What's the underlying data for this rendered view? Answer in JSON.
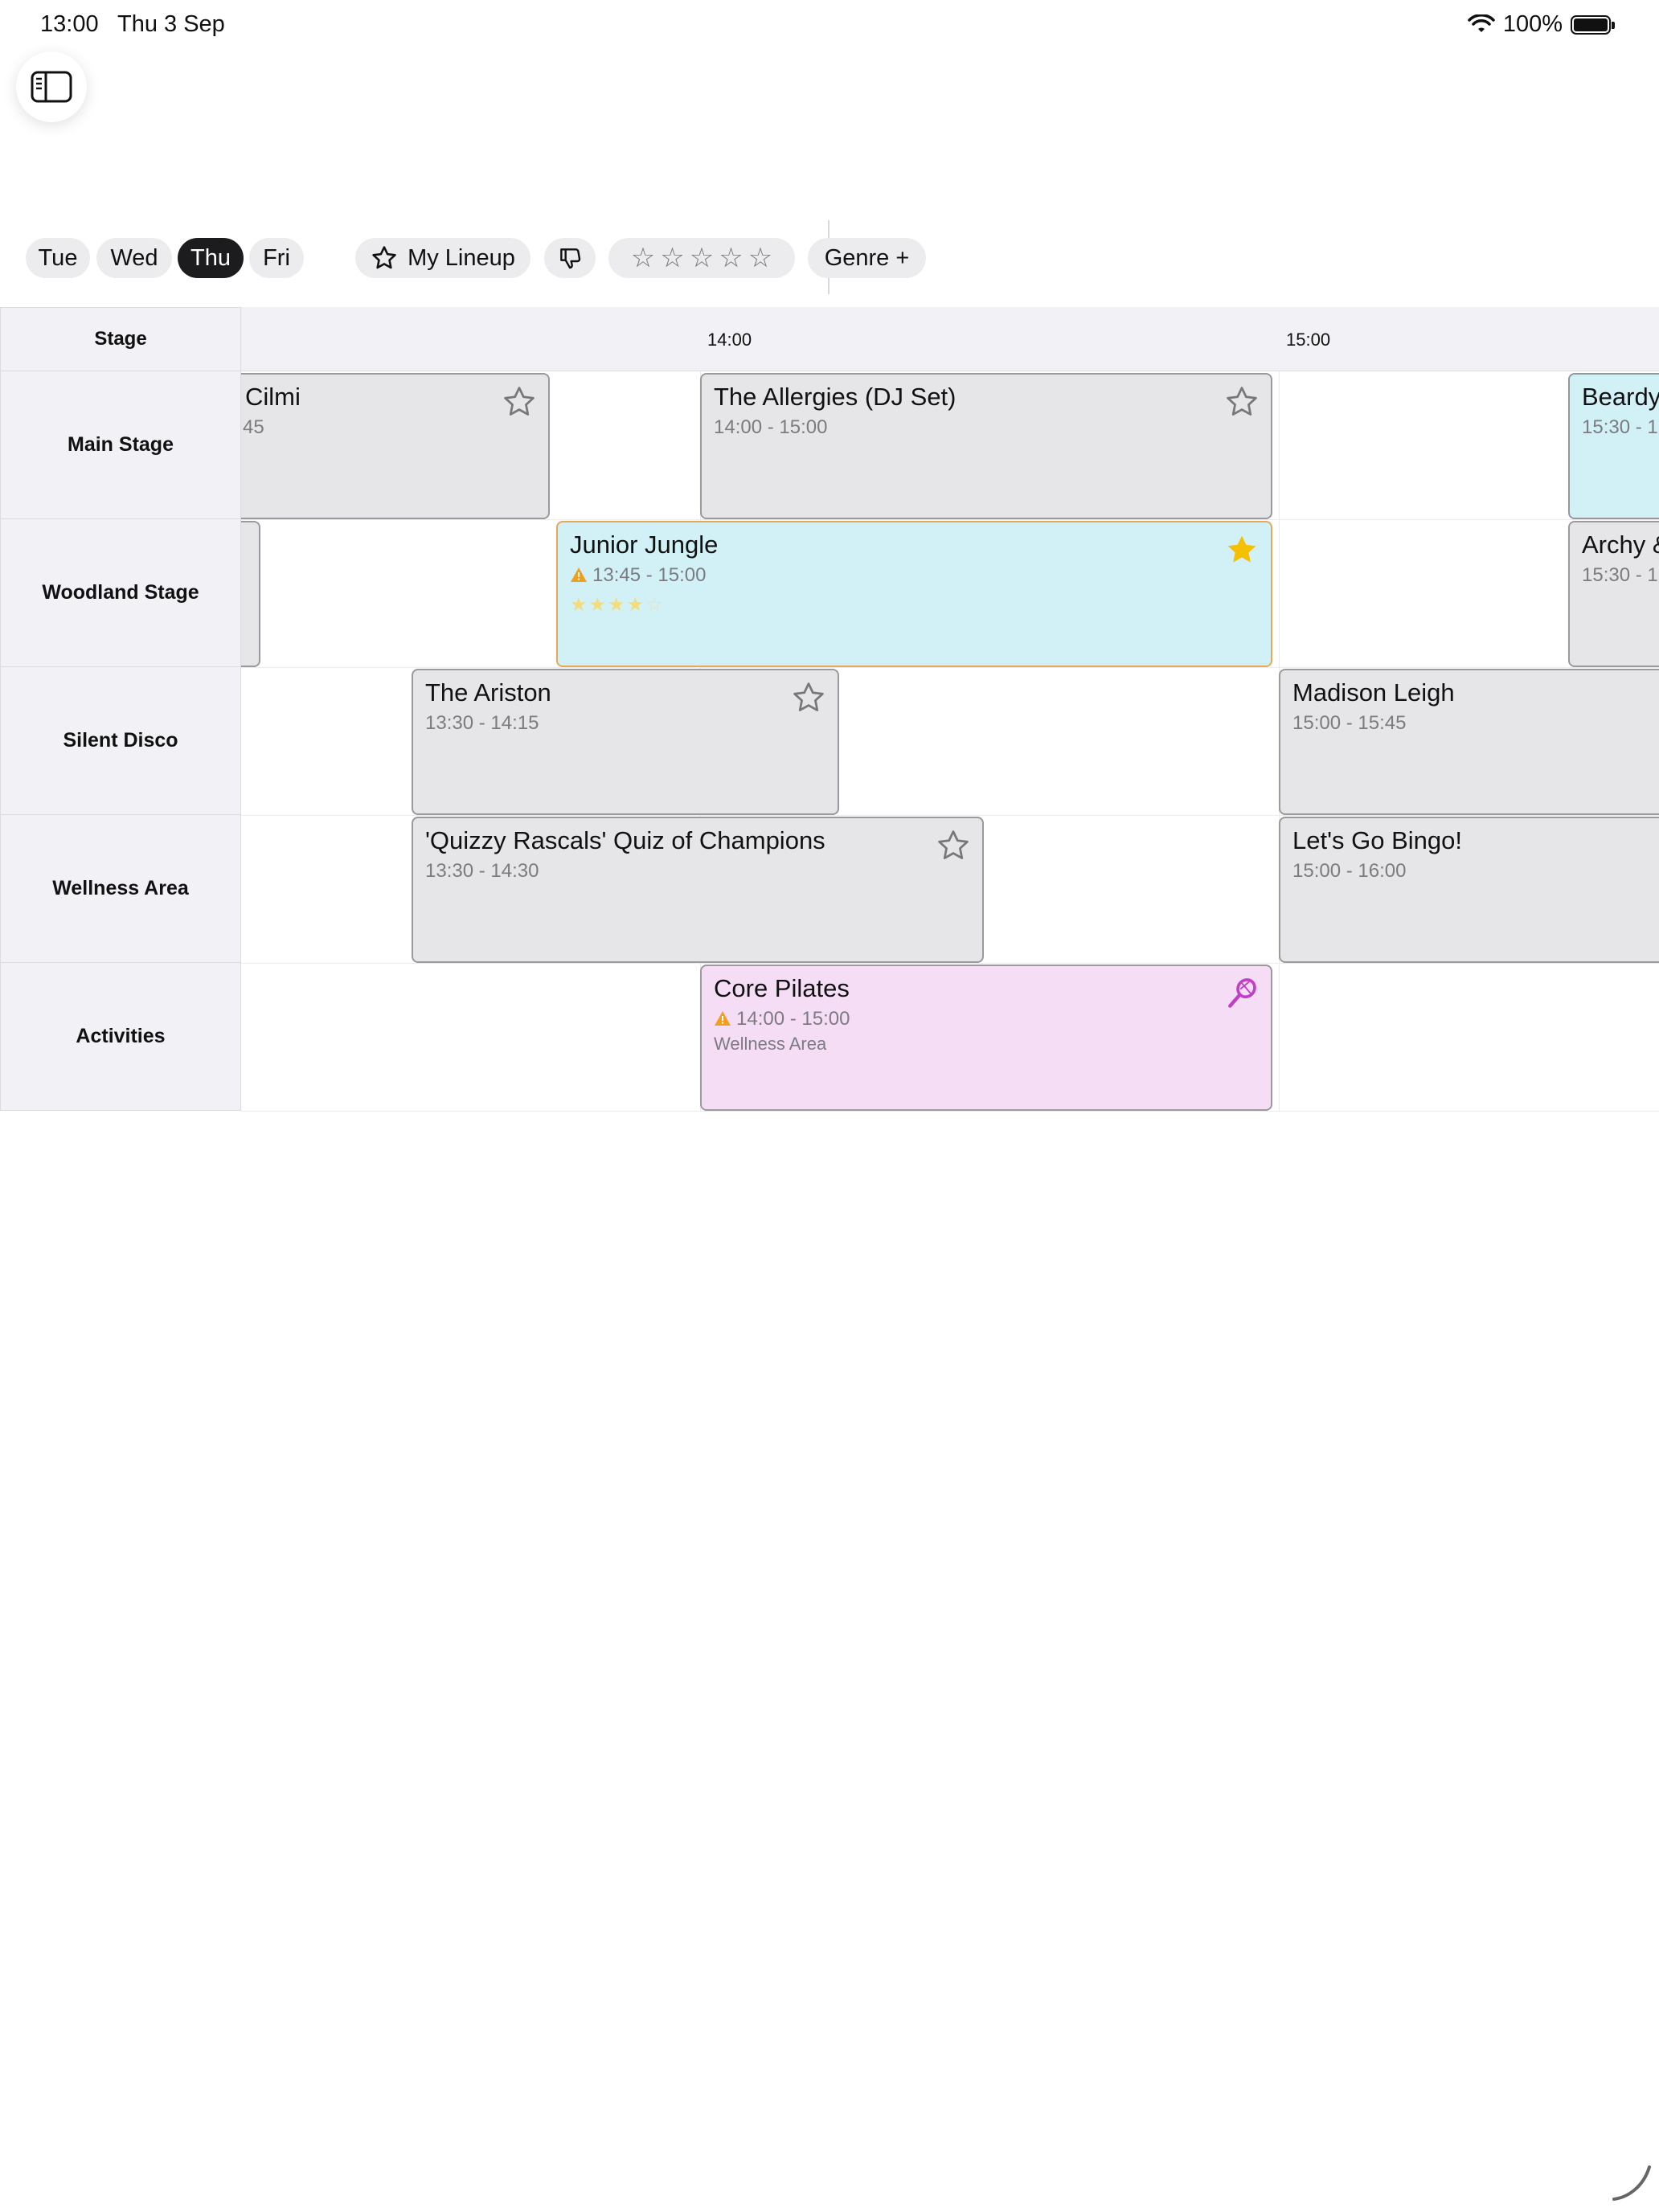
{
  "status": {
    "time": "13:00",
    "date": "Thu 3 Sep",
    "battery": "100%"
  },
  "toolbar": {
    "days": [
      {
        "label": "Tue",
        "active": false
      },
      {
        "label": "Wed",
        "active": false
      },
      {
        "label": "Thu",
        "active": true
      },
      {
        "label": "Fri",
        "active": false
      }
    ],
    "my_lineup_label": "My Lineup",
    "rating_stars": [
      "☆",
      "☆",
      "☆",
      "☆",
      "☆"
    ],
    "genre_label": "Genre +"
  },
  "schedule": {
    "stage_header": "Stage",
    "time_labels": [
      "14:00",
      "15:00"
    ],
    "stages": [
      "Main Stage",
      "Woodland Stage",
      "Silent Disco",
      "Wellness Area",
      "Activities"
    ],
    "events": [
      {
        "title": "Cilmi",
        "time": "45"
      },
      {
        "title": "The Allergies (DJ Set)",
        "time": "14:00 - 15:00"
      },
      {
        "title": "Beardy",
        "time": "15:30 - 1"
      },
      {
        "title": "Junior Jungle",
        "time": "13:45 - 15:00",
        "rating": "★★★★",
        "rating_empty": "☆"
      },
      {
        "title": "Archy &",
        "time": "15:30 - 1"
      },
      {
        "title": "The Ariston",
        "time": "13:30 - 14:15"
      },
      {
        "title": "Madison Leigh",
        "time": "15:00 - 15:45"
      },
      {
        "title": "'Quizzy Rascals' Quiz of Champions",
        "time": "13:30 - 14:30"
      },
      {
        "title": "Let's Go Bingo!",
        "time": "15:00 - 16:00"
      },
      {
        "title": "Core Pilates",
        "time": "14:00 - 15:00",
        "location": "Wellness Area"
      }
    ]
  },
  "colors": {
    "accent_selected": "#1c1c1e",
    "favorite": "#f5c000",
    "warning": "#f0a020",
    "activity": "#c23ec9"
  }
}
